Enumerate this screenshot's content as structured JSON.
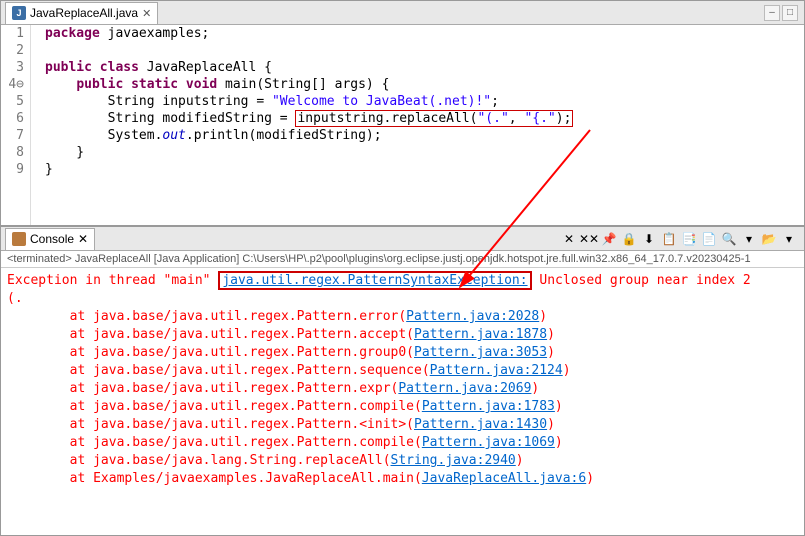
{
  "editor_tab": {
    "filename": "JavaReplaceAll.java",
    "icon_letter": "J"
  },
  "code": {
    "lines": [
      {
        "n": "1",
        "segs": [
          {
            "t": "package",
            "c": "kw"
          },
          {
            "t": " javaexamples;",
            "c": ""
          }
        ]
      },
      {
        "n": "2",
        "segs": [
          {
            "t": "",
            "c": ""
          }
        ]
      },
      {
        "n": "3",
        "segs": [
          {
            "t": "public",
            "c": "kw"
          },
          {
            "t": " ",
            "c": ""
          },
          {
            "t": "class",
            "c": "kw"
          },
          {
            "t": " JavaReplaceAll {",
            "c": ""
          }
        ]
      },
      {
        "n": "4",
        "flag": "fold",
        "segs": [
          {
            "t": "    ",
            "c": ""
          },
          {
            "t": "public",
            "c": "kw"
          },
          {
            "t": " ",
            "c": ""
          },
          {
            "t": "static",
            "c": "kw"
          },
          {
            "t": " ",
            "c": ""
          },
          {
            "t": "void",
            "c": "kw"
          },
          {
            "t": " main(String[] args) {",
            "c": ""
          }
        ]
      },
      {
        "n": "5",
        "segs": [
          {
            "t": "        String inputstring = ",
            "c": ""
          },
          {
            "t": "\"Welcome to JavaBeat(.net)!\"",
            "c": "str"
          },
          {
            "t": ";",
            "c": ""
          }
        ]
      },
      {
        "n": "6",
        "hl": true,
        "segs": [
          {
            "t": "        String modifiedString = ",
            "c": ""
          },
          {
            "t": "inputstring.replaceAll(",
            "c": "",
            "boxstart": true
          },
          {
            "t": "\"(.\"",
            "c": "str"
          },
          {
            "t": ", ",
            "c": ""
          },
          {
            "t": "\"{.\"",
            "c": "str"
          },
          {
            "t": ");",
            "c": "",
            "boxend": true
          }
        ]
      },
      {
        "n": "7",
        "segs": [
          {
            "t": "        System.",
            "c": ""
          },
          {
            "t": "out",
            "c": "fld"
          },
          {
            "t": ".println(modifiedString);",
            "c": ""
          }
        ]
      },
      {
        "n": "8",
        "segs": [
          {
            "t": "    }",
            "c": ""
          }
        ]
      },
      {
        "n": "9",
        "segs": [
          {
            "t": "}",
            "c": ""
          }
        ]
      }
    ]
  },
  "console_tab": {
    "label": "Console"
  },
  "terminated_line": "<terminated> JavaReplaceAll [Java Application] C:\\Users\\HP\\.p2\\pool\\plugins\\org.eclipse.justj.openjdk.hotspot.jre.full.win32.x86_64_17.0.7.v20230425-1",
  "exception": {
    "prefix": "Exception in thread \"main\" ",
    "class": "java.util.regex.PatternSyntaxException:",
    "msg": " Unclosed group near index 2",
    "detail": "(."
  },
  "stack": [
    {
      "pkg": "at java.base/java.util.regex.Pattern.error(",
      "loc": "Pattern.java:2028",
      "end": ")"
    },
    {
      "pkg": "at java.base/java.util.regex.Pattern.accept(",
      "loc": "Pattern.java:1878",
      "end": ")"
    },
    {
      "pkg": "at java.base/java.util.regex.Pattern.group0(",
      "loc": "Pattern.java:3053",
      "end": ")"
    },
    {
      "pkg": "at java.base/java.util.regex.Pattern.sequence(",
      "loc": "Pattern.java:2124",
      "end": ")"
    },
    {
      "pkg": "at java.base/java.util.regex.Pattern.expr(",
      "loc": "Pattern.java:2069",
      "end": ")"
    },
    {
      "pkg": "at java.base/java.util.regex.Pattern.compile(",
      "loc": "Pattern.java:1783",
      "end": ")"
    },
    {
      "pkg": "at java.base/java.util.regex.Pattern.<init>(",
      "loc": "Pattern.java:1430",
      "end": ")"
    },
    {
      "pkg": "at java.base/java.util.regex.Pattern.compile(",
      "loc": "Pattern.java:1069",
      "end": ")"
    },
    {
      "pkg": "at java.base/java.lang.String.replaceAll(",
      "loc": "String.java:2940",
      "end": ")"
    },
    {
      "pkg": "at Examples/javaexamples.JavaReplaceAll.main(",
      "loc": "JavaReplaceAll.java:6",
      "end": ")"
    }
  ],
  "console_buttons": [
    "✕",
    "✕✕",
    "📌",
    "🔒",
    "⬇",
    "📋",
    "📑",
    "📄",
    "🔍",
    "▾",
    "📂",
    "▾"
  ]
}
